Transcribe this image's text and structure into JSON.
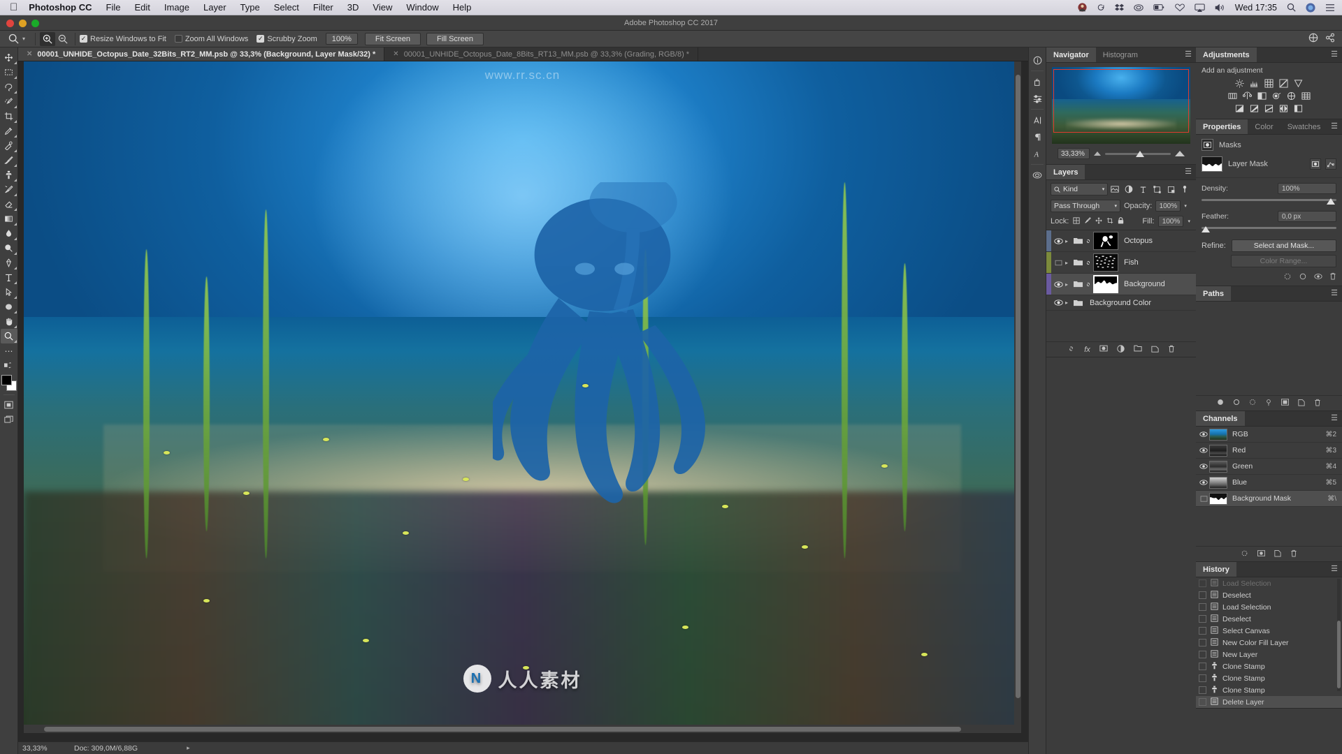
{
  "macbar": {
    "apple_icon": "apple-logo",
    "app_name": "Photoshop CC",
    "menus": [
      "File",
      "Edit",
      "Image",
      "Layer",
      "Type",
      "Select",
      "Filter",
      "3D",
      "View",
      "Window",
      "Help"
    ],
    "status_icons": [
      "user-avatar-icon",
      "flickr-icon",
      "dropbox-icon",
      "creative-cloud-icon",
      "battery-icon",
      "heart-icon",
      "airplay-icon",
      "volume-icon"
    ],
    "clock": "Wed 17:35",
    "search_icon": "search-icon",
    "siri_icon": "siri-icon",
    "notification_icon": "notification-center-icon"
  },
  "window": {
    "title": "Adobe Photoshop CC 2017"
  },
  "options_bar": {
    "tool_icon": "zoom-tool-icon",
    "preset_caret": "chevron-down-icon",
    "zoom_in_icon": "zoom-in-icon",
    "zoom_out_icon": "zoom-out-icon",
    "checkboxes": [
      {
        "label": "Resize Windows to Fit",
        "checked": true
      },
      {
        "label": "Zoom All Windows",
        "checked": false
      },
      {
        "label": "Scrubby Zoom",
        "checked": true
      }
    ],
    "zoom_value": "100%",
    "buttons": [
      "Fit Screen",
      "Fill Screen"
    ],
    "right_icons": [
      "workspace-switcher-icon",
      "share-icon"
    ]
  },
  "toolbar": {
    "tools": [
      "move-tool",
      "rectangular-marquee-tool",
      "lasso-tool",
      "quick-selection-tool",
      "crop-tool",
      "eyedropper-tool",
      "spot-healing-brush-tool",
      "brush-tool",
      "clone-stamp-tool",
      "history-brush-tool",
      "eraser-tool",
      "gradient-tool",
      "blur-tool",
      "dodge-tool",
      "pen-tool",
      "horizontal-type-tool",
      "path-selection-tool",
      "ellipse-tool",
      "hand-tool",
      "zoom-tool"
    ],
    "selected_tool": "zoom-tool",
    "more_tools_icon": "more-tools-icon",
    "edit_toolbar_icon": "edit-toolbar-icon",
    "foreground_color": "#000000",
    "background_color": "#ffffff",
    "quick_mask_icon": "quick-mask-mode-icon",
    "screen_mode_icon": "screen-mode-icon"
  },
  "tabs": [
    {
      "label": "00001_UNHIDE_Octopus_Date_32Bits_RT2_MM.psb @ 33,3% (Background, Layer Mask/32) *",
      "active": true,
      "close_icon": "close-icon"
    },
    {
      "label": "00001_UNHIDE_Octopus_Date_8Bits_RT13_MM.psb @ 33,3% (Grading, RGB/8) *",
      "active": false,
      "close_icon": "close-icon"
    }
  ],
  "canvas": {
    "watermark_top": "www.rr.sc.cn",
    "watermark_bottom": "人人素材",
    "watermark_badge": "N"
  },
  "status_bar": {
    "zoom": "33,33%",
    "doc_info": "Doc: 309,0M/6,88G",
    "arrow_icon": "chevron-right-icon"
  },
  "rail": {
    "icons": [
      "info-icon",
      "tool-presets-icon",
      "adjustments-rail-icon",
      "character-icon",
      "paragraph-icon",
      "character-styles-icon",
      "color-rail-icon"
    ]
  },
  "navigator_panel": {
    "tabs": [
      {
        "label": "Navigator",
        "active": true
      },
      {
        "label": "Histogram",
        "active": false
      }
    ],
    "menu_icon": "panel-menu-icon",
    "zoom_value": "33,33%",
    "zoom_out_icon": "zoom-out-small-icon",
    "zoom_in_icon": "zoom-in-large-icon",
    "view_box_color": "#e23b2e"
  },
  "layers_panel": {
    "tabs": [
      {
        "label": "Layers",
        "active": true
      }
    ],
    "menu_icon": "panel-menu-icon",
    "filter_label": "Kind",
    "filter_icon": "search-icon",
    "filter_type_icons": [
      "filter-pixel-icon",
      "filter-adjustment-icon",
      "filter-type-icon",
      "filter-shape-icon",
      "filter-smartobject-icon",
      "filter-toggle-icon"
    ],
    "blend_mode": "Pass Through",
    "opacity_label": "Opacity:",
    "opacity_value": "100%",
    "lock_label": "Lock:",
    "lock_icons": [
      "lock-transparency-icon",
      "lock-image-icon",
      "lock-position-icon",
      "lock-artboard-icon",
      "lock-all-icon"
    ],
    "fill_label": "Fill:",
    "fill_value": "100%",
    "layers": [
      {
        "name": "Octopus",
        "visible": true,
        "selected": false,
        "color": "#5c6e8c",
        "thumb": "octopus-mask-thumb",
        "group": true,
        "linked": true
      },
      {
        "name": "Fish",
        "visible": false,
        "selected": false,
        "color": "#7c8a3c",
        "thumb": "fish-mask-thumb",
        "group": true,
        "linked": true
      },
      {
        "name": "Background",
        "visible": true,
        "selected": true,
        "color": "#6a5aa0",
        "thumb": "background-mask-thumb",
        "group": true,
        "linked": true
      },
      {
        "name": "Background Color",
        "visible": true,
        "selected": false,
        "color": "#3c3c3c",
        "thumb": "",
        "group": true,
        "linked": false
      }
    ],
    "footer_icons": [
      "link-layers-icon",
      "layer-style-icon",
      "add-mask-icon",
      "new-fill-adjustment-icon",
      "new-group-icon",
      "new-layer-icon",
      "delete-layer-icon"
    ]
  },
  "adjustments_panel": {
    "tabs": [
      {
        "label": "Adjustments",
        "active": true
      }
    ],
    "menu_icon": "panel-menu-icon",
    "subtitle": "Add an adjustment",
    "rows": [
      [
        "brightness-contrast-icon",
        "levels-icon",
        "curves-icon",
        "exposure-icon",
        "vibrance-icon"
      ],
      [
        "hue-saturation-icon",
        "color-balance-icon",
        "black-white-icon",
        "photo-filter-icon",
        "channel-mixer-icon",
        "color-lookup-icon"
      ],
      [
        "invert-icon",
        "posterize-icon",
        "threshold-icon",
        "gradient-map-icon",
        "selective-color-icon"
      ]
    ]
  },
  "properties_panel": {
    "tabs": [
      {
        "label": "Properties",
        "active": true
      },
      {
        "label": "Color",
        "active": false
      },
      {
        "label": "Swatches",
        "active": false
      }
    ],
    "menu_icon": "panel-menu-icon",
    "header_label": "Masks",
    "header_icon": "masks-icon",
    "mask_label": "Layer Mask",
    "mask_buttons": [
      "pixel-mask-icon",
      "vector-mask-icon"
    ],
    "density_label": "Density:",
    "density_value": "100%",
    "feather_label": "Feather:",
    "feather_value": "0,0 px",
    "refine_label": "Refine:",
    "select_and_mask_button": "Select and Mask...",
    "color_range_button": "Color Range...",
    "footer_icons": [
      "load-selection-icon",
      "apply-mask-icon",
      "toggle-mask-icon",
      "delete-mask-icon"
    ]
  },
  "paths_panel": {
    "tabs": [
      {
        "label": "Paths",
        "active": true
      }
    ],
    "menu_icon": "panel-menu-icon",
    "footer_icons": [
      "fill-path-icon",
      "stroke-path-icon",
      "load-path-selection-icon",
      "make-work-path-icon",
      "add-mask-path-icon",
      "new-path-icon",
      "delete-path-icon"
    ]
  },
  "channels_panel": {
    "tabs": [
      {
        "label": "Channels",
        "active": true
      }
    ],
    "menu_icon": "panel-menu-icon",
    "channels": [
      {
        "name": "RGB",
        "shortcut": "⌘2",
        "visible": true,
        "selected": false,
        "thumb": "rgb-thumb"
      },
      {
        "name": "Red",
        "shortcut": "⌘3",
        "visible": true,
        "selected": false,
        "thumb": "red-thumb"
      },
      {
        "name": "Green",
        "shortcut": "⌘4",
        "visible": true,
        "selected": false,
        "thumb": "green-thumb"
      },
      {
        "name": "Blue",
        "shortcut": "⌘5",
        "visible": true,
        "selected": false,
        "thumb": "blue-thumb"
      },
      {
        "name": "Background Mask",
        "shortcut": "⌘\\",
        "visible": false,
        "selected": true,
        "thumb": "mask-thumb"
      }
    ],
    "footer_icons": [
      "load-channel-selection-icon",
      "save-selection-icon",
      "new-channel-icon",
      "delete-channel-icon"
    ]
  },
  "history_panel": {
    "tabs": [
      {
        "label": "History",
        "active": true
      }
    ],
    "menu_icon": "panel-menu-icon",
    "states": [
      {
        "name": "Load Selection",
        "icon": "selection-state-icon",
        "selected": false,
        "clipped": true
      },
      {
        "name": "Deselect",
        "icon": "selection-state-icon",
        "selected": false
      },
      {
        "name": "Load Selection",
        "icon": "selection-state-icon",
        "selected": false
      },
      {
        "name": "Deselect",
        "icon": "selection-state-icon",
        "selected": false
      },
      {
        "name": "Select Canvas",
        "icon": "selection-state-icon",
        "selected": false
      },
      {
        "name": "New Color Fill Layer",
        "icon": "selection-state-icon",
        "selected": false
      },
      {
        "name": "New Layer",
        "icon": "selection-state-icon",
        "selected": false
      },
      {
        "name": "Clone Stamp",
        "icon": "clone-stamp-state-icon",
        "selected": false
      },
      {
        "name": "Clone Stamp",
        "icon": "clone-stamp-state-icon",
        "selected": false
      },
      {
        "name": "Clone Stamp",
        "icon": "clone-stamp-state-icon",
        "selected": false
      },
      {
        "name": "Delete Layer",
        "icon": "selection-state-icon",
        "selected": true
      }
    ]
  }
}
